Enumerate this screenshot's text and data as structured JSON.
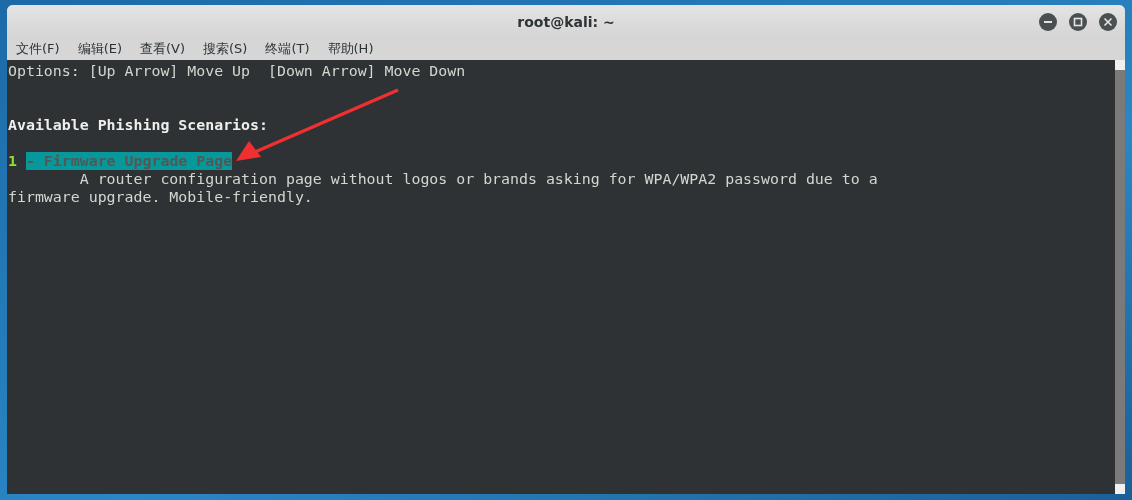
{
  "window": {
    "title": "root@kali: ~"
  },
  "menu": [
    {
      "label": "文件(F)"
    },
    {
      "label": "编辑(E)"
    },
    {
      "label": "查看(V)"
    },
    {
      "label": "搜索(S)"
    },
    {
      "label": "终端(T)"
    },
    {
      "label": "帮助(H)"
    }
  ],
  "terminal": {
    "options_line": "Options: [Up Arrow] Move Up  [Down Arrow] Move Down",
    "heading": "Available Phishing Scenarios:",
    "scenarios": [
      {
        "number": "1",
        "label": "- Firmware Upgrade Page",
        "selected": true,
        "description_lines": [
          "        A router configuration page without logos or brands asking for WPA/WPA2 password due to a",
          "firmware upgrade. Mobile-friendly."
        ]
      }
    ]
  }
}
